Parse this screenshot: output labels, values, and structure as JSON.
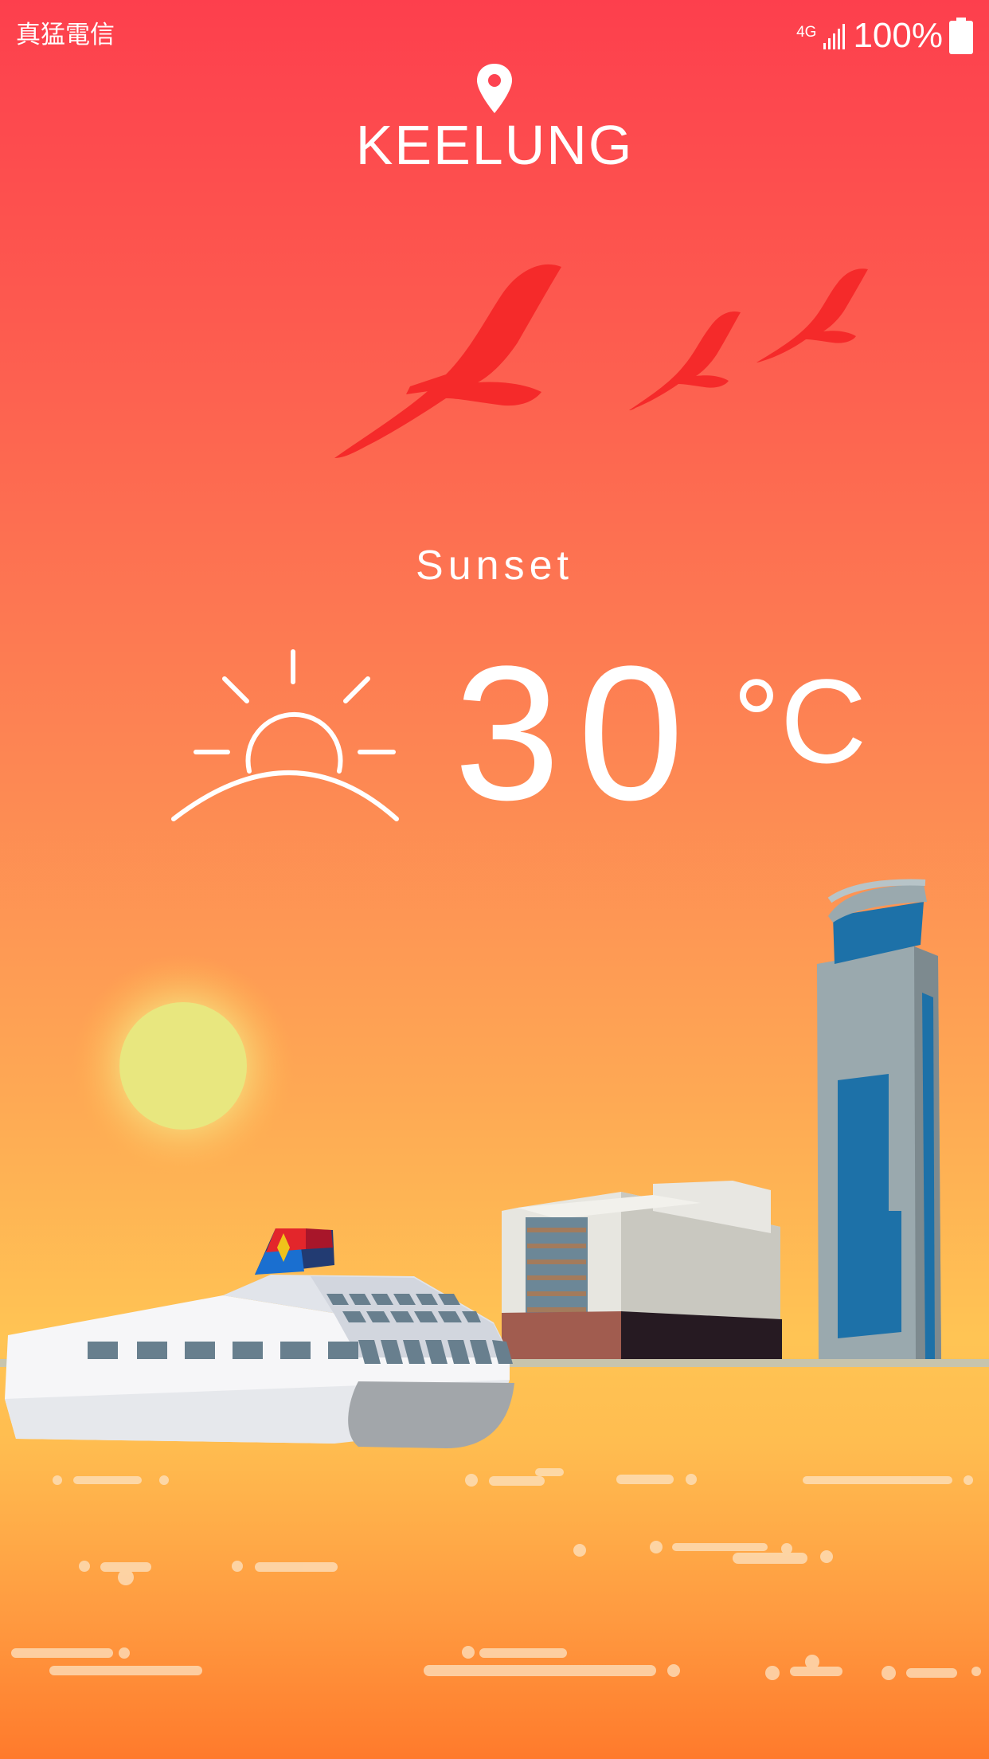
{
  "status_bar": {
    "carrier": "真猛電信",
    "network": "4G",
    "battery": "100%"
  },
  "location": {
    "city": "KEELUNG",
    "icon": "location-pin-icon"
  },
  "weather": {
    "condition": "Sunset",
    "temperature": "30",
    "unit": "°C",
    "icon": "sunset-icon"
  },
  "illustration": {
    "scene": "harbor",
    "bird_color": "#f52a2a",
    "sun_color": "#e8e77f",
    "water_streak_color": "#fde3c3"
  }
}
